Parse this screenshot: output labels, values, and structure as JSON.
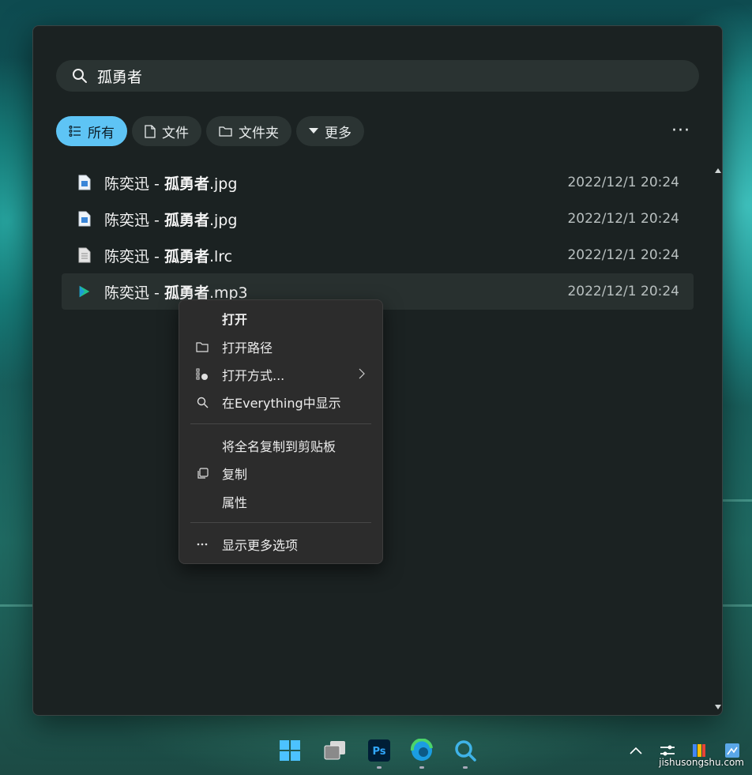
{
  "search": {
    "query": "孤勇者"
  },
  "filters": [
    {
      "label": "所有",
      "icon": "list-icon",
      "active": true
    },
    {
      "label": "文件",
      "icon": "file-icon",
      "active": false
    },
    {
      "label": "文件夹",
      "icon": "folder-icon",
      "active": false
    },
    {
      "label": "更多",
      "icon": "caret-down-icon",
      "active": false
    }
  ],
  "more_menu": "···",
  "results": [
    {
      "prefix": "陈奕迅 - ",
      "match": "孤勇者",
      "ext": ".jpg",
      "date": "2022/12/1 20:24",
      "icon": "image-file-icon"
    },
    {
      "prefix": "陈奕迅 - ",
      "match": "孤勇者",
      "ext": ".jpg",
      "date": "2022/12/1 20:24",
      "icon": "image-file-icon"
    },
    {
      "prefix": "陈奕迅 - ",
      "match": "孤勇者",
      "ext": ".lrc",
      "date": "2022/12/1 20:24",
      "icon": "text-file-icon"
    },
    {
      "prefix": "陈奕迅 - ",
      "match": "孤勇者",
      "ext": ".mp3",
      "date": "2022/12/1 20:24",
      "icon": "audio-file-icon"
    }
  ],
  "context_menu": {
    "open": "打开",
    "open_path": "打开路径",
    "open_with": "打开方式...",
    "show_in_everything": "在Everything中显示",
    "copy_fullname": "将全名复制到剪贴板",
    "copy": "复制",
    "properties": "属性",
    "show_more": "显示更多选项"
  },
  "taskbar": {
    "apps": [
      "windows-start-icon",
      "task-view-icon",
      "photoshop-icon",
      "edge-icon",
      "search-app-icon"
    ],
    "photoshop_label": "Ps",
    "tray": [
      "chevron-up-icon",
      "settings-icon",
      "google-icon",
      "app-icon"
    ]
  },
  "watermark": "jishusongshu.com",
  "colors": {
    "accent": "#5ec4f5",
    "window_bg": "#1b2222",
    "menu_bg": "#2c2c2c"
  }
}
